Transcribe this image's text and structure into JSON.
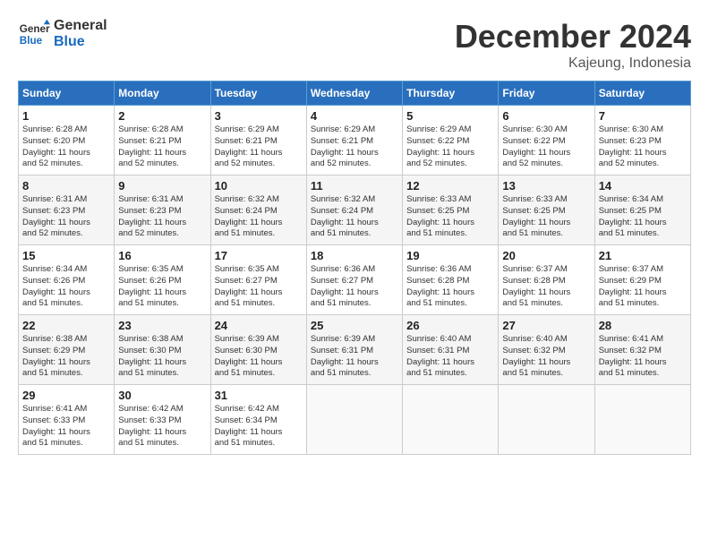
{
  "header": {
    "logo_line1": "General",
    "logo_line2": "Blue",
    "month": "December 2024",
    "location": "Kajeung, Indonesia"
  },
  "days_of_week": [
    "Sunday",
    "Monday",
    "Tuesday",
    "Wednesday",
    "Thursday",
    "Friday",
    "Saturday"
  ],
  "weeks": [
    [
      {
        "num": "1",
        "info": "Sunrise: 6:28 AM\nSunset: 6:20 PM\nDaylight: 11 hours\nand 52 minutes."
      },
      {
        "num": "2",
        "info": "Sunrise: 6:28 AM\nSunset: 6:21 PM\nDaylight: 11 hours\nand 52 minutes."
      },
      {
        "num": "3",
        "info": "Sunrise: 6:29 AM\nSunset: 6:21 PM\nDaylight: 11 hours\nand 52 minutes."
      },
      {
        "num": "4",
        "info": "Sunrise: 6:29 AM\nSunset: 6:21 PM\nDaylight: 11 hours\nand 52 minutes."
      },
      {
        "num": "5",
        "info": "Sunrise: 6:29 AM\nSunset: 6:22 PM\nDaylight: 11 hours\nand 52 minutes."
      },
      {
        "num": "6",
        "info": "Sunrise: 6:30 AM\nSunset: 6:22 PM\nDaylight: 11 hours\nand 52 minutes."
      },
      {
        "num": "7",
        "info": "Sunrise: 6:30 AM\nSunset: 6:23 PM\nDaylight: 11 hours\nand 52 minutes."
      }
    ],
    [
      {
        "num": "8",
        "info": "Sunrise: 6:31 AM\nSunset: 6:23 PM\nDaylight: 11 hours\nand 52 minutes."
      },
      {
        "num": "9",
        "info": "Sunrise: 6:31 AM\nSunset: 6:23 PM\nDaylight: 11 hours\nand 52 minutes."
      },
      {
        "num": "10",
        "info": "Sunrise: 6:32 AM\nSunset: 6:24 PM\nDaylight: 11 hours\nand 51 minutes."
      },
      {
        "num": "11",
        "info": "Sunrise: 6:32 AM\nSunset: 6:24 PM\nDaylight: 11 hours\nand 51 minutes."
      },
      {
        "num": "12",
        "info": "Sunrise: 6:33 AM\nSunset: 6:25 PM\nDaylight: 11 hours\nand 51 minutes."
      },
      {
        "num": "13",
        "info": "Sunrise: 6:33 AM\nSunset: 6:25 PM\nDaylight: 11 hours\nand 51 minutes."
      },
      {
        "num": "14",
        "info": "Sunrise: 6:34 AM\nSunset: 6:25 PM\nDaylight: 11 hours\nand 51 minutes."
      }
    ],
    [
      {
        "num": "15",
        "info": "Sunrise: 6:34 AM\nSunset: 6:26 PM\nDaylight: 11 hours\nand 51 minutes."
      },
      {
        "num": "16",
        "info": "Sunrise: 6:35 AM\nSunset: 6:26 PM\nDaylight: 11 hours\nand 51 minutes."
      },
      {
        "num": "17",
        "info": "Sunrise: 6:35 AM\nSunset: 6:27 PM\nDaylight: 11 hours\nand 51 minutes."
      },
      {
        "num": "18",
        "info": "Sunrise: 6:36 AM\nSunset: 6:27 PM\nDaylight: 11 hours\nand 51 minutes."
      },
      {
        "num": "19",
        "info": "Sunrise: 6:36 AM\nSunset: 6:28 PM\nDaylight: 11 hours\nand 51 minutes."
      },
      {
        "num": "20",
        "info": "Sunrise: 6:37 AM\nSunset: 6:28 PM\nDaylight: 11 hours\nand 51 minutes."
      },
      {
        "num": "21",
        "info": "Sunrise: 6:37 AM\nSunset: 6:29 PM\nDaylight: 11 hours\nand 51 minutes."
      }
    ],
    [
      {
        "num": "22",
        "info": "Sunrise: 6:38 AM\nSunset: 6:29 PM\nDaylight: 11 hours\nand 51 minutes."
      },
      {
        "num": "23",
        "info": "Sunrise: 6:38 AM\nSunset: 6:30 PM\nDaylight: 11 hours\nand 51 minutes."
      },
      {
        "num": "24",
        "info": "Sunrise: 6:39 AM\nSunset: 6:30 PM\nDaylight: 11 hours\nand 51 minutes."
      },
      {
        "num": "25",
        "info": "Sunrise: 6:39 AM\nSunset: 6:31 PM\nDaylight: 11 hours\nand 51 minutes."
      },
      {
        "num": "26",
        "info": "Sunrise: 6:40 AM\nSunset: 6:31 PM\nDaylight: 11 hours\nand 51 minutes."
      },
      {
        "num": "27",
        "info": "Sunrise: 6:40 AM\nSunset: 6:32 PM\nDaylight: 11 hours\nand 51 minutes."
      },
      {
        "num": "28",
        "info": "Sunrise: 6:41 AM\nSunset: 6:32 PM\nDaylight: 11 hours\nand 51 minutes."
      }
    ],
    [
      {
        "num": "29",
        "info": "Sunrise: 6:41 AM\nSunset: 6:33 PM\nDaylight: 11 hours\nand 51 minutes."
      },
      {
        "num": "30",
        "info": "Sunrise: 6:42 AM\nSunset: 6:33 PM\nDaylight: 11 hours\nand 51 minutes."
      },
      {
        "num": "31",
        "info": "Sunrise: 6:42 AM\nSunset: 6:34 PM\nDaylight: 11 hours\nand 51 minutes."
      },
      null,
      null,
      null,
      null
    ]
  ]
}
